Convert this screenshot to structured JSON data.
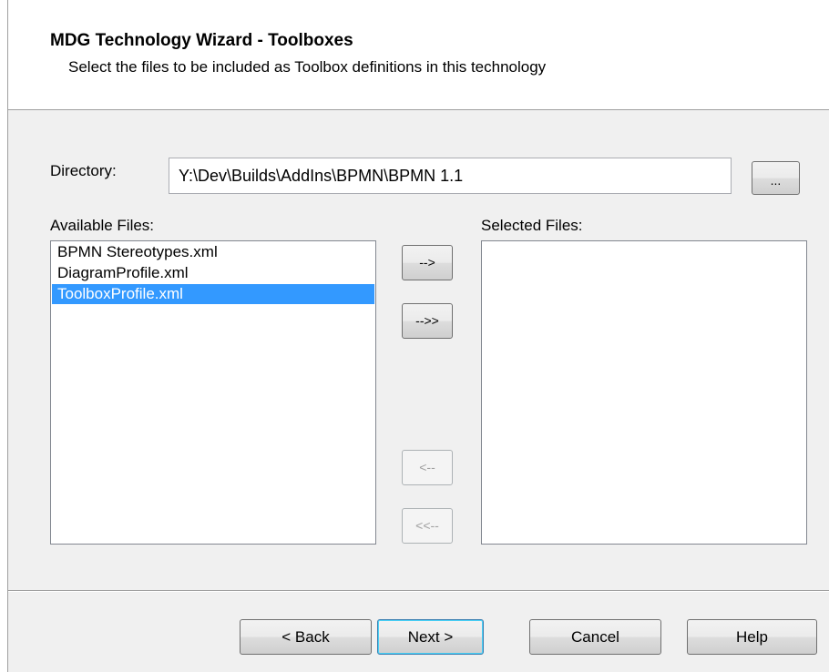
{
  "header": {
    "title": "MDG Technology Wizard - Toolboxes",
    "subtitle": "Select the files to be included as Toolbox definitions in this technology"
  },
  "directory": {
    "label": "Directory:",
    "value": "Y:\\Dev\\Builds\\AddIns\\BPMN\\BPMN 1.1",
    "browse_label": "..."
  },
  "available": {
    "label": "Available Files:",
    "items": [
      {
        "label": "BPMN Stereotypes.xml",
        "selected": false
      },
      {
        "label": "DiagramProfile.xml",
        "selected": false
      },
      {
        "label": "ToolboxProfile.xml",
        "selected": true
      }
    ]
  },
  "selected": {
    "label": "Selected Files:",
    "items": []
  },
  "transfer": {
    "add_label": "-->",
    "add_all_label": "-->>",
    "remove_label": "<--",
    "remove_all_label": "<<--"
  },
  "footer": {
    "back_label": "< Back",
    "next_label": "Next >",
    "cancel_label": "Cancel",
    "help_label": "Help"
  }
}
